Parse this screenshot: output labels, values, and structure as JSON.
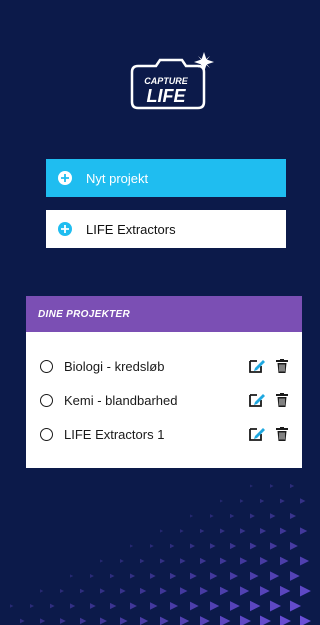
{
  "logo": {
    "line1": "CAPTURE",
    "line2": "LIFE"
  },
  "actions": {
    "new_project": "Nyt projekt",
    "extractors": "LIFE Extractors"
  },
  "projects_panel": {
    "title": "DINE PROJEKTER",
    "items": [
      {
        "label": "Biologi - kredsløb"
      },
      {
        "label": "Kemi - blandbarhed"
      },
      {
        "label": "LIFE Extractors 1"
      }
    ]
  },
  "colors": {
    "background": "#0c1a4a",
    "accent_cyan": "#1fbdf0",
    "header_purple": "#7b4fb4",
    "triangle_purple": "#6b4fd8",
    "edit_blue": "#1fa8e0"
  },
  "icons": [
    "plus-icon",
    "radio-icon",
    "edit-icon",
    "trash-icon",
    "camera-logo"
  ]
}
